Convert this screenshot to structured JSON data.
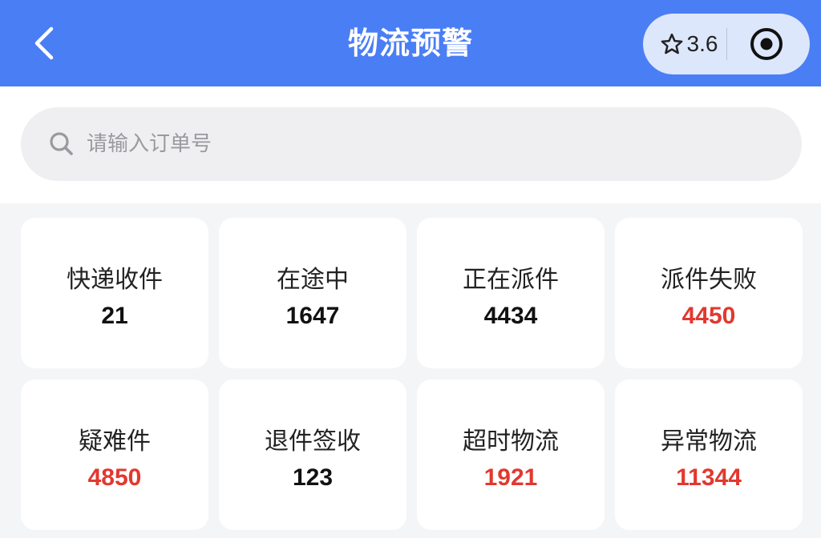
{
  "header": {
    "title": "物流预警",
    "back_icon": "chevron-left-icon",
    "rating": "3.6",
    "rating_icon": "star-outline-icon",
    "target_icon": "target-icon",
    "bg_color": "#4a7ef5"
  },
  "search": {
    "placeholder": "请输入订单号",
    "value": "",
    "icon": "search-icon"
  },
  "colors": {
    "normal_value": "#111111",
    "alert_value": "#e2382f"
  },
  "cards": [
    {
      "label": "快递收件",
      "value": "21",
      "alert": false
    },
    {
      "label": "在途中",
      "value": "1647",
      "alert": false
    },
    {
      "label": "正在派件",
      "value": "4434",
      "alert": false
    },
    {
      "label": "派件失败",
      "value": "4450",
      "alert": true
    },
    {
      "label": "疑难件",
      "value": "4850",
      "alert": true
    },
    {
      "label": "退件签收",
      "value": "123",
      "alert": false
    },
    {
      "label": "超时物流",
      "value": "1921",
      "alert": true
    },
    {
      "label": "异常物流",
      "value": "11344",
      "alert": true
    }
  ]
}
